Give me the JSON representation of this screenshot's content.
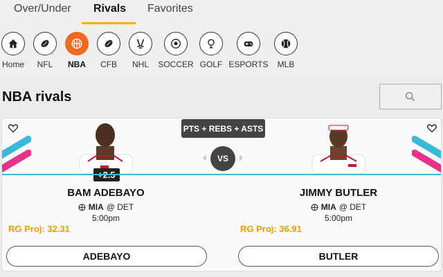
{
  "tabs": [
    {
      "label": "Over/Under"
    },
    {
      "label": "Rivals",
      "active": true
    },
    {
      "label": "Favorites"
    }
  ],
  "sports": [
    {
      "label": "Home",
      "icon": "home-icon"
    },
    {
      "label": "NFL",
      "icon": "football-icon"
    },
    {
      "label": "NBA",
      "icon": "basketball-icon",
      "active": true
    },
    {
      "label": "CFB",
      "icon": "football-icon"
    },
    {
      "label": "NHL",
      "icon": "hockey-icon"
    },
    {
      "label": "SOCCER",
      "icon": "soccer-ball-icon"
    },
    {
      "label": "GOLF",
      "icon": "golf-icon"
    },
    {
      "label": "ESPORTS",
      "icon": "gamepad-icon"
    },
    {
      "label": "MLB",
      "icon": "baseball-icon"
    }
  ],
  "section": {
    "title": "NBA rivals"
  },
  "matchup": {
    "stat": "PTS + REBS + ASTS",
    "vs": "VS",
    "spread": "+2.5",
    "left": {
      "name": "BAM ADEBAYO",
      "team": "MIA",
      "opp": "@ DET",
      "time": "5:00pm",
      "proj": "RG Proj: 32.31",
      "button": "ADEBAYO"
    },
    "right": {
      "name": "JIMMY BUTLER",
      "team": "MIA",
      "opp": "@ DET",
      "time": "5:00pm",
      "proj": "RG Proj: 36.91",
      "button": "BUTLER"
    }
  },
  "colors": {
    "accent": "#f2b300",
    "active_sport": "#f26a21",
    "proj": "#f29a00",
    "line": "#3ab8d8",
    "stripe_pink": "#e8318a",
    "stripe_blue": "#3ab8d8"
  }
}
